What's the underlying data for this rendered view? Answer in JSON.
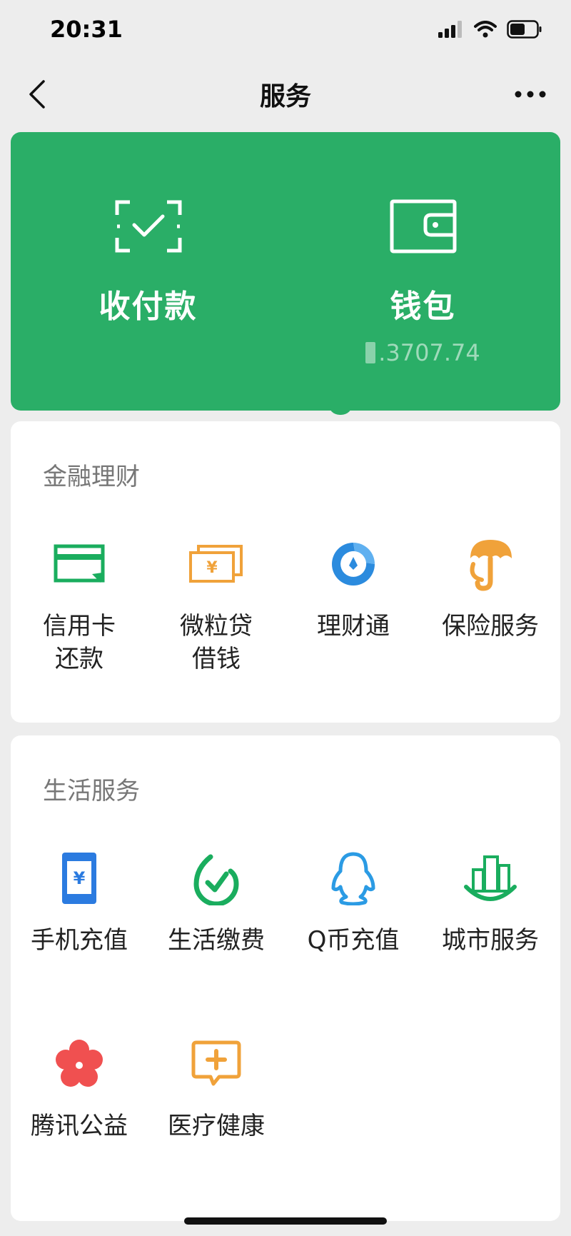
{
  "status_bar": {
    "time": "20:31"
  },
  "nav": {
    "title": "服务"
  },
  "wallet_card": {
    "pay_label": "收付款",
    "wallet_label": "钱包",
    "balance": ".3707.74"
  },
  "finance": {
    "title": "金融理财",
    "items": [
      {
        "label": "信用卡\n还款",
        "icon": "credit-card-icon",
        "color": "#1aad5e"
      },
      {
        "label": "微粒贷\n借钱",
        "icon": "yuan-bills-icon",
        "color": "#f0a23a"
      },
      {
        "label": "理财通",
        "icon": "licaitong-icon",
        "color": "#2b8bde"
      },
      {
        "label": "保险服务",
        "icon": "insurance-umbrella-icon",
        "color": "#f0a23a"
      }
    ]
  },
  "life": {
    "title": "生活服务",
    "items": [
      {
        "label": "手机充值",
        "icon": "phone-recharge-icon",
        "color": "#2b7be0"
      },
      {
        "label": "生活缴费",
        "icon": "utility-payment-icon",
        "color": "#1aad5e"
      },
      {
        "label": "Q币充值",
        "icon": "qq-penguin-icon",
        "color": "#2b9be4"
      },
      {
        "label": "城市服务",
        "icon": "city-buildings-icon",
        "color": "#1aad5e"
      },
      {
        "label": "腾讯公益",
        "icon": "charity-flower-icon",
        "color": "#f05050"
      },
      {
        "label": "医疗健康",
        "icon": "medical-cross-icon",
        "color": "#f0a23a"
      }
    ]
  }
}
